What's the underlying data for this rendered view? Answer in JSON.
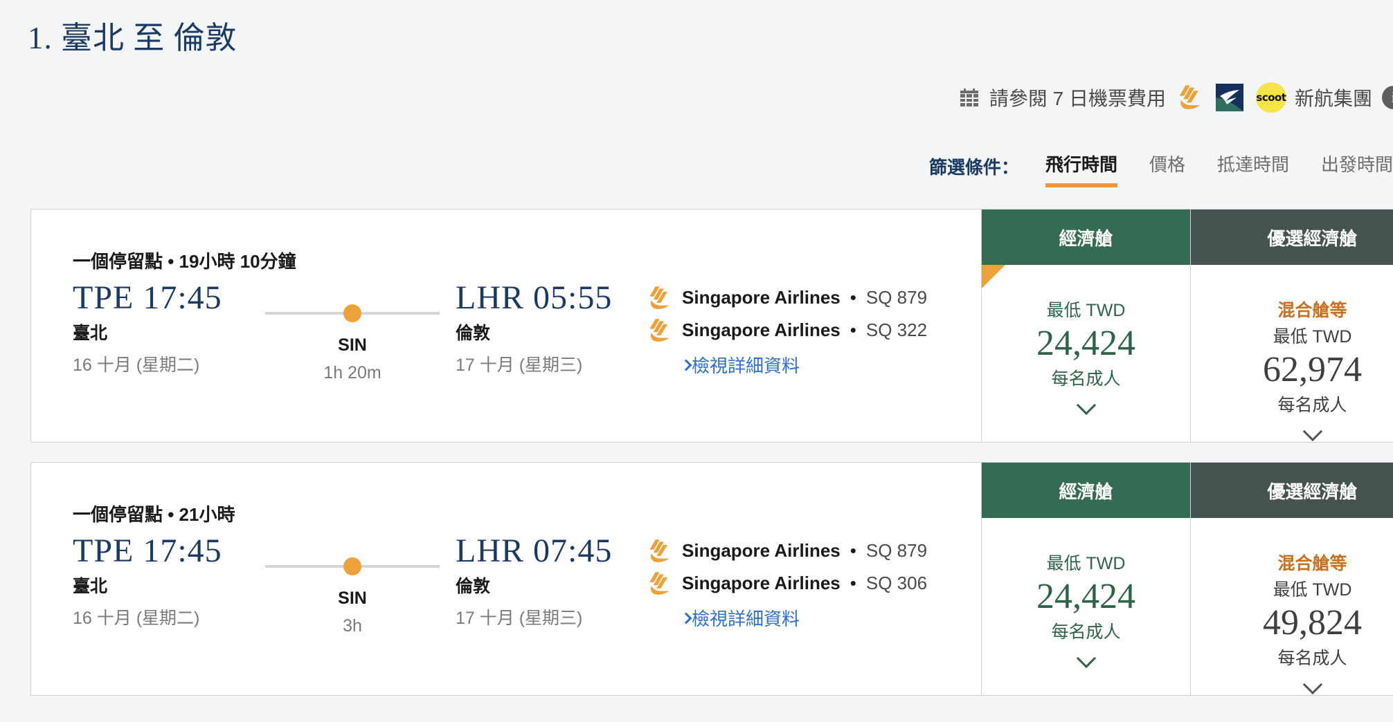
{
  "page": {
    "title": "1. 臺北 至 倫敦",
    "background_color": "#F4F5F6"
  },
  "header": {
    "calendar_icon": "calendar-icon",
    "fare_calendar_text": "請參閱 7 日機票費用",
    "logos": [
      {
        "name": "singapore-airlines-logo",
        "color": "#EDA239"
      },
      {
        "name": "silkair-logo",
        "color": "#16305C"
      },
      {
        "name": "scoot-logo",
        "label": "scoot",
        "color": "#F5E442"
      }
    ],
    "group_text": "新航集團",
    "info_icon": "info-icon"
  },
  "filters": {
    "label": "篩選條件：",
    "tabs": [
      {
        "label": "飛行時間",
        "active": true
      },
      {
        "label": "價格",
        "active": false
      },
      {
        "label": "抵達時間",
        "active": false
      },
      {
        "label": "出發時間",
        "active": false
      }
    ],
    "active_underline_color": "#EB9B34"
  },
  "fare_columns": {
    "economy_label": "經濟艙",
    "premium_label": "優選經濟艙",
    "economy_header_color": "#356B52",
    "premium_header_color": "#455250",
    "lowest_label": "最低 TWD",
    "per_adult_label": "每名成人",
    "mixed_cabin_label": "混合艙等",
    "mixed_cabin_color": "#C8701D"
  },
  "flights": [
    {
      "stops_summary": "一個停留點 • 19小時 10分鐘",
      "departure": {
        "code_time": "TPE 17:45",
        "city": "臺北",
        "date": "16 十月 (星期二)"
      },
      "arrival": {
        "code_time": "LHR 05:55",
        "city": "倫敦",
        "date": "17 十月 (星期三)"
      },
      "layover": {
        "airport": "SIN",
        "duration": "1h 20m"
      },
      "segments": [
        {
          "airline": "Singapore Airlines",
          "separator": "•",
          "flight_number": "SQ 879"
        },
        {
          "airline": "Singapore Airlines",
          "separator": "•",
          "flight_number": "SQ 322"
        }
      ],
      "details_link": "檢視詳細資料",
      "economy": {
        "lowest_label": "最低 TWD",
        "price": "24,424",
        "per_adult": "每名成人",
        "best_deal_flag": true
      },
      "premium": {
        "mixed_cabin": "混合艙等",
        "lowest_label": "最低 TWD",
        "price": "62,974",
        "per_adult": "每名成人"
      }
    },
    {
      "stops_summary": "一個停留點 • 21小時",
      "departure": {
        "code_time": "TPE 17:45",
        "city": "臺北",
        "date": "16 十月 (星期二)"
      },
      "arrival": {
        "code_time": "LHR 07:45",
        "city": "倫敦",
        "date": "17 十月 (星期三)"
      },
      "layover": {
        "airport": "SIN",
        "duration": "3h"
      },
      "segments": [
        {
          "airline": "Singapore Airlines",
          "separator": "•",
          "flight_number": "SQ 879"
        },
        {
          "airline": "Singapore Airlines",
          "separator": "•",
          "flight_number": "SQ 306"
        }
      ],
      "details_link": "檢視詳細資料",
      "economy": {
        "lowest_label": "最低 TWD",
        "price": "24,424",
        "per_adult": "每名成人",
        "best_deal_flag": false
      },
      "premium": {
        "mixed_cabin": "混合艙等",
        "lowest_label": "最低 TWD",
        "price": "49,824",
        "per_adult": "每名成人"
      }
    }
  ]
}
